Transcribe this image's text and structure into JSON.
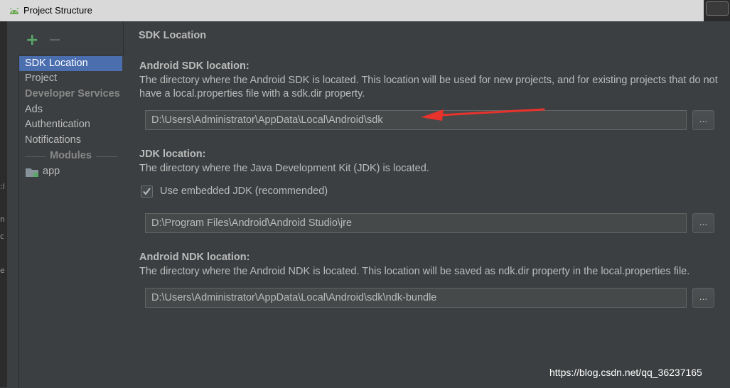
{
  "window": {
    "title": "Project Structure"
  },
  "sidebar": {
    "add_label": "+",
    "remove_label": "−",
    "items": [
      {
        "label": "SDK Location",
        "selected": true
      },
      {
        "label": "Project"
      }
    ],
    "dev_services_header": "Developer Services",
    "dev_items": [
      "Ads",
      "Authentication",
      "Notifications"
    ],
    "modules_header": "Modules",
    "modules": [
      {
        "label": "app",
        "icon": "module-folder-icon"
      }
    ]
  },
  "main": {
    "heading": "SDK Location",
    "sdk": {
      "title": "Android SDK location:",
      "description": "The directory where the Android SDK is located. This location will be used for new projects, and for existing projects that do not have a local.properties file with a sdk.dir property.",
      "path": "D:\\Users\\Administrator\\AppData\\Local\\Android\\sdk",
      "browse_label": "..."
    },
    "jdk": {
      "title": "JDK location:",
      "description": "The directory where the Java Development Kit (JDK) is located.",
      "embedded_label": "Use embedded JDK (recommended)",
      "embedded_checked": true,
      "path": "D:\\Program Files\\Android\\Android Studio\\jre",
      "browse_label": "..."
    },
    "ndk": {
      "title": "Android NDK location:",
      "description": "The directory where the Android NDK is located. This location will be saved as ndk.dir property in the local.properties file.",
      "path": "D:\\Users\\Administrator\\AppData\\Local\\Android\\sdk\\ndk-bundle",
      "browse_label": "..."
    }
  },
  "watermark": "https://blog.csdn.net/qq_36237165",
  "colors": {
    "background": "#3c3f41",
    "selection": "#4b6eaf",
    "arrow": "#e8322c",
    "add": "#59a869"
  }
}
